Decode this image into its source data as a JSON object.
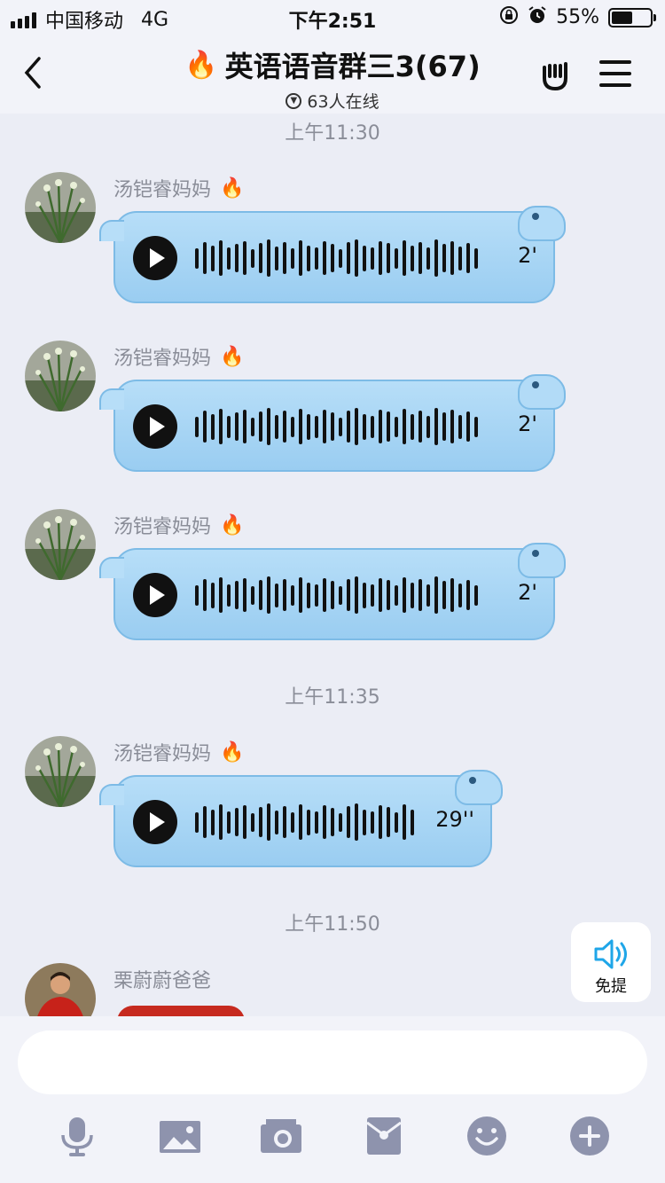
{
  "status_bar": {
    "carrier": "中国移动",
    "network": "4G",
    "time": "下午2:51",
    "battery_percent": "55%",
    "battery_level": 0.55
  },
  "nav": {
    "title": "英语语音群三3(67)",
    "online": "63人在线"
  },
  "timestamps": [
    "上午11:30",
    "上午11:35",
    "上午11:50"
  ],
  "messages": [
    {
      "sender": "汤铠睿妈妈",
      "duration": "2'"
    },
    {
      "sender": "汤铠睿妈妈",
      "duration": "2'"
    },
    {
      "sender": "汤铠睿妈妈",
      "duration": "2'"
    },
    {
      "sender": "汤铠睿妈妈",
      "duration": "29''"
    },
    {
      "sender": "栗蔚蔚爸爸"
    }
  ],
  "free_mention": {
    "label": "免提"
  },
  "input": {
    "placeholder": ""
  },
  "colors": {
    "bubble": "#a9d6f5",
    "accent_blue": "#1fa6e8",
    "icon_gray": "#8e93ad"
  },
  "icons": [
    "microphone-icon",
    "image-icon",
    "camera-icon",
    "red-packet-icon",
    "emoji-icon",
    "plus-icon"
  ]
}
